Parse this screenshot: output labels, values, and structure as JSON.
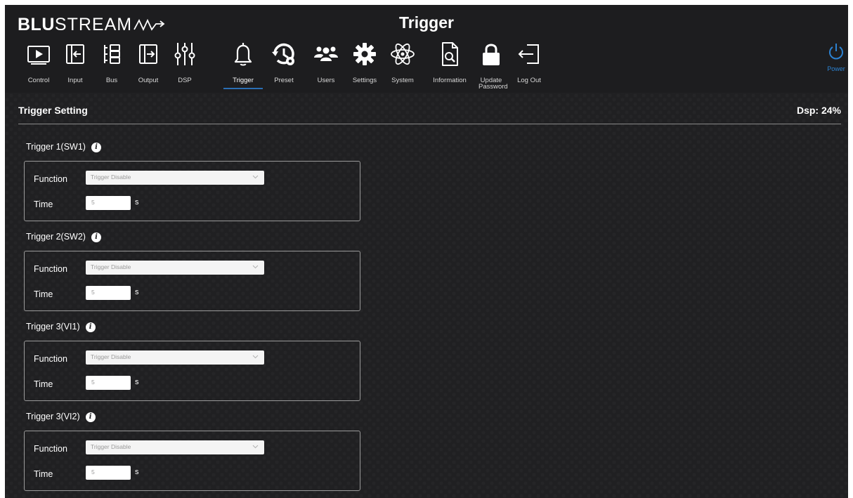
{
  "brand": {
    "bold": "BLU",
    "light": "STREAM"
  },
  "page_heading": "Trigger",
  "nav": [
    {
      "label": "Control",
      "icon": "control-icon"
    },
    {
      "label": "Input",
      "icon": "input-icon"
    },
    {
      "label": "Bus",
      "icon": "bus-icon"
    },
    {
      "label": "Output",
      "icon": "output-icon"
    },
    {
      "label": "DSP",
      "icon": "dsp-icon"
    },
    {
      "label": "Trigger",
      "icon": "bell-icon",
      "active": true
    },
    {
      "label": "Preset",
      "icon": "preset-icon"
    },
    {
      "label": "Users",
      "icon": "users-icon"
    },
    {
      "label": "Settings",
      "icon": "gear-icon"
    },
    {
      "label": "System",
      "icon": "atom-icon"
    },
    {
      "label": "Information",
      "icon": "document-search-icon"
    },
    {
      "label": "Update Password",
      "icon": "lock-icon"
    },
    {
      "label": "Log Out",
      "icon": "logout-icon"
    }
  ],
  "power": {
    "label": "Power",
    "icon": "power-icon",
    "color": "#2c82d2"
  },
  "section": {
    "title": "Trigger Setting",
    "dsp": "Dsp: 24%"
  },
  "labels": {
    "function": "Function",
    "time": "Time",
    "unit": "s"
  },
  "triggers": [
    {
      "title": "Trigger 1(SW1)",
      "function": "Trigger Disable",
      "time": "5"
    },
    {
      "title": "Trigger 2(SW2)",
      "function": "Trigger Disable",
      "time": "5"
    },
    {
      "title": "Trigger 3(VI1)",
      "function": "Trigger Disable",
      "time": "5"
    },
    {
      "title": "Trigger 3(VI2)",
      "function": "Trigger Disable",
      "time": "5"
    }
  ],
  "colors": {
    "background": "#202022",
    "accent": "#2c82d2",
    "active_underline": "#2a6fb4"
  }
}
